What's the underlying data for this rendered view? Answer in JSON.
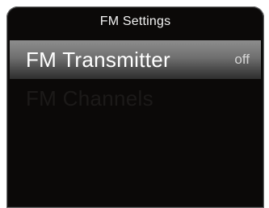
{
  "header": {
    "title": "FM Settings"
  },
  "menu": {
    "items": [
      {
        "label": "FM Transmitter",
        "value": "off",
        "selected": true
      },
      {
        "label": "FM Channels",
        "selected": false
      }
    ]
  },
  "colors": {
    "background": "#0b0908",
    "selected_highlight": "#7a7a7a",
    "text_primary": "#ffffff",
    "text_dim": "#1c1a19"
  }
}
